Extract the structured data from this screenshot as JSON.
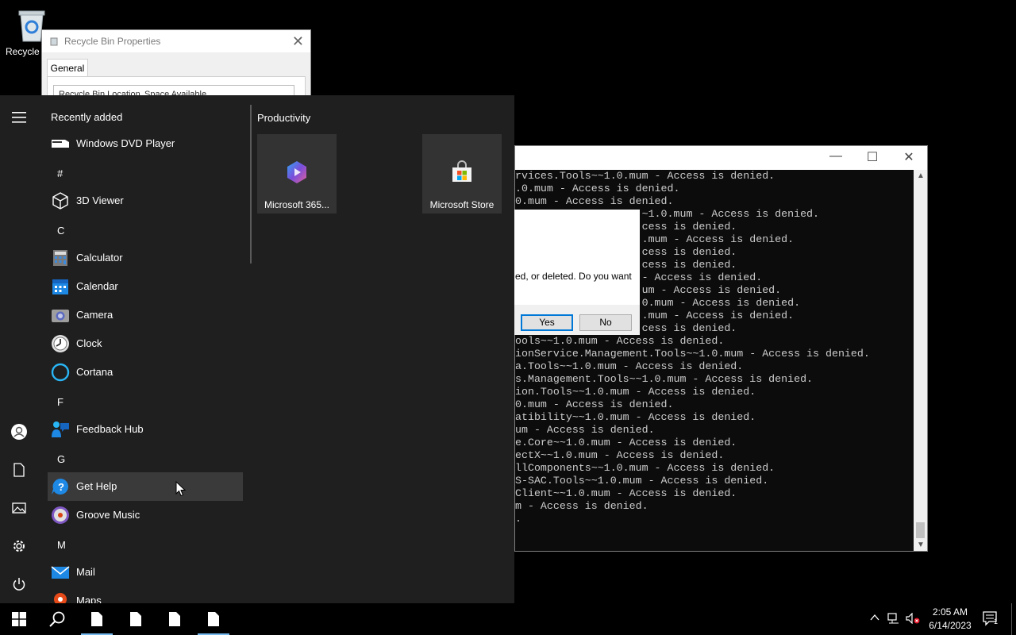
{
  "desktop": {
    "recycle_bin_label": "Recycle Bin"
  },
  "props_window": {
    "title": "Recycle Bin Properties",
    "tab_general": "General",
    "col_location": "Recycle Bin Location",
    "col_space": "Space Available"
  },
  "console": {
    "lines": [
      "rvices.Tools~~1.0.mum - Access is denied.",
      ".0.mum - Access is denied.",
      "0.mum - Access is denied.",
      "                    ~1.0.mum - Access is denied.",
      "                    cess is denied.",
      "                    .mum - Access is denied.",
      "                    cess is denied.",
      "                    cess is denied.",
      "                    - Access is denied.",
      "                    um - Access is denied.",
      "                    0.mum - Access is denied.",
      "                    .mum - Access is denied.",
      "                    cess is denied.",
      "ools~~1.0.mum - Access is denied.",
      "ionService.Management.Tools~~1.0.mum - Access is denied.",
      "a.Tools~~1.0.mum - Access is denied.",
      "s.Management.Tools~~1.0.mum - Access is denied.",
      "ion.Tools~~1.0.mum - Access is denied.",
      "0.mum - Access is denied.",
      "atibility~~1.0.mum - Access is denied.",
      "um - Access is denied.",
      "e.Core~~1.0.mum - Access is denied.",
      "ectX~~1.0.mum - Access is denied.",
      "llComponents~~1.0.mum - Access is denied.",
      "S-SAC.Tools~~1.0.mum - Access is denied.",
      "Client~~1.0.mum - Access is denied.",
      "m - Access is denied.",
      "."
    ]
  },
  "dialog": {
    "message": "ed, or deleted. Do you want",
    "yes_label": "Yes",
    "no_label": "No"
  },
  "start_menu": {
    "recently_added_label": "Recently added",
    "productivity_label": "Productivity",
    "apps": [
      {
        "name": "Windows DVD Player",
        "icon": "dvd-icon"
      },
      {
        "letter": "#"
      },
      {
        "name": "3D Viewer",
        "icon": "cube-icon"
      },
      {
        "letter": "C"
      },
      {
        "name": "Calculator",
        "icon": "calculator-icon"
      },
      {
        "name": "Calendar",
        "icon": "calendar-icon"
      },
      {
        "name": "Camera",
        "icon": "camera-icon"
      },
      {
        "name": "Clock",
        "icon": "clock-icon"
      },
      {
        "name": "Cortana",
        "icon": "cortana-icon"
      },
      {
        "letter": "F"
      },
      {
        "name": "Feedback Hub",
        "icon": "feedback-icon"
      },
      {
        "letter": "G"
      },
      {
        "name": "Get Help",
        "icon": "help-icon"
      },
      {
        "name": "Groove Music",
        "icon": "music-icon"
      },
      {
        "letter": "M"
      },
      {
        "name": "Mail",
        "icon": "mail-icon"
      },
      {
        "name": "Maps",
        "icon": "maps-icon"
      }
    ],
    "tiles": [
      {
        "name": "Microsoft 365...",
        "icon": "m365-icon"
      },
      {
        "name": "Microsoft Store",
        "icon": "store-icon"
      }
    ]
  },
  "taskbar": {
    "time": "2:05 AM",
    "date": "6/14/2023",
    "notification_count": "1"
  }
}
